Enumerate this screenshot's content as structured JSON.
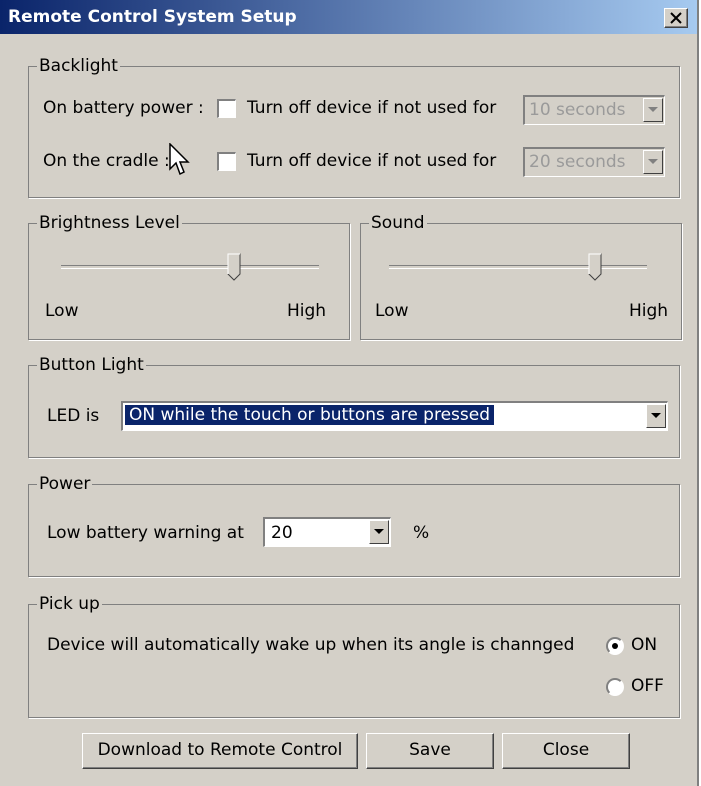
{
  "window": {
    "title": "Remote Control System Setup",
    "close_icon": "close-icon"
  },
  "backlight": {
    "title": "Backlight",
    "battery_label": "On battery power :",
    "battery_check_label": "Turn off device if not used for",
    "battery_value": "10 seconds",
    "battery_checked": false,
    "cradle_label": "On the cradle :",
    "cradle_check_label": "Turn off device if not used for",
    "cradle_value": "20 seconds",
    "cradle_checked": false
  },
  "brightness": {
    "title": "Brightness Level",
    "low": "Low",
    "high": "High",
    "level": 0.67
  },
  "sound": {
    "title": "Sound",
    "low": "Low",
    "high": "High",
    "level": 0.8
  },
  "button_light": {
    "title": "Button Light",
    "label": "LED is",
    "value": "ON while the touch or buttons are pressed"
  },
  "power": {
    "title": "Power",
    "label": "Low battery warning at",
    "value": "20",
    "unit": "%"
  },
  "pickup": {
    "title": "Pick up",
    "description": "Device will automatically wake up when its angle is channged",
    "on_label": "ON",
    "off_label": "OFF",
    "selected": "ON"
  },
  "buttons": {
    "download": "Download to Remote Control",
    "save": "Save",
    "close": "Close"
  },
  "colors": {
    "titlebar_start": "#0a246a",
    "titlebar_end": "#a6caf0",
    "face": "#d4d0c8",
    "selection": "#0a246a"
  }
}
